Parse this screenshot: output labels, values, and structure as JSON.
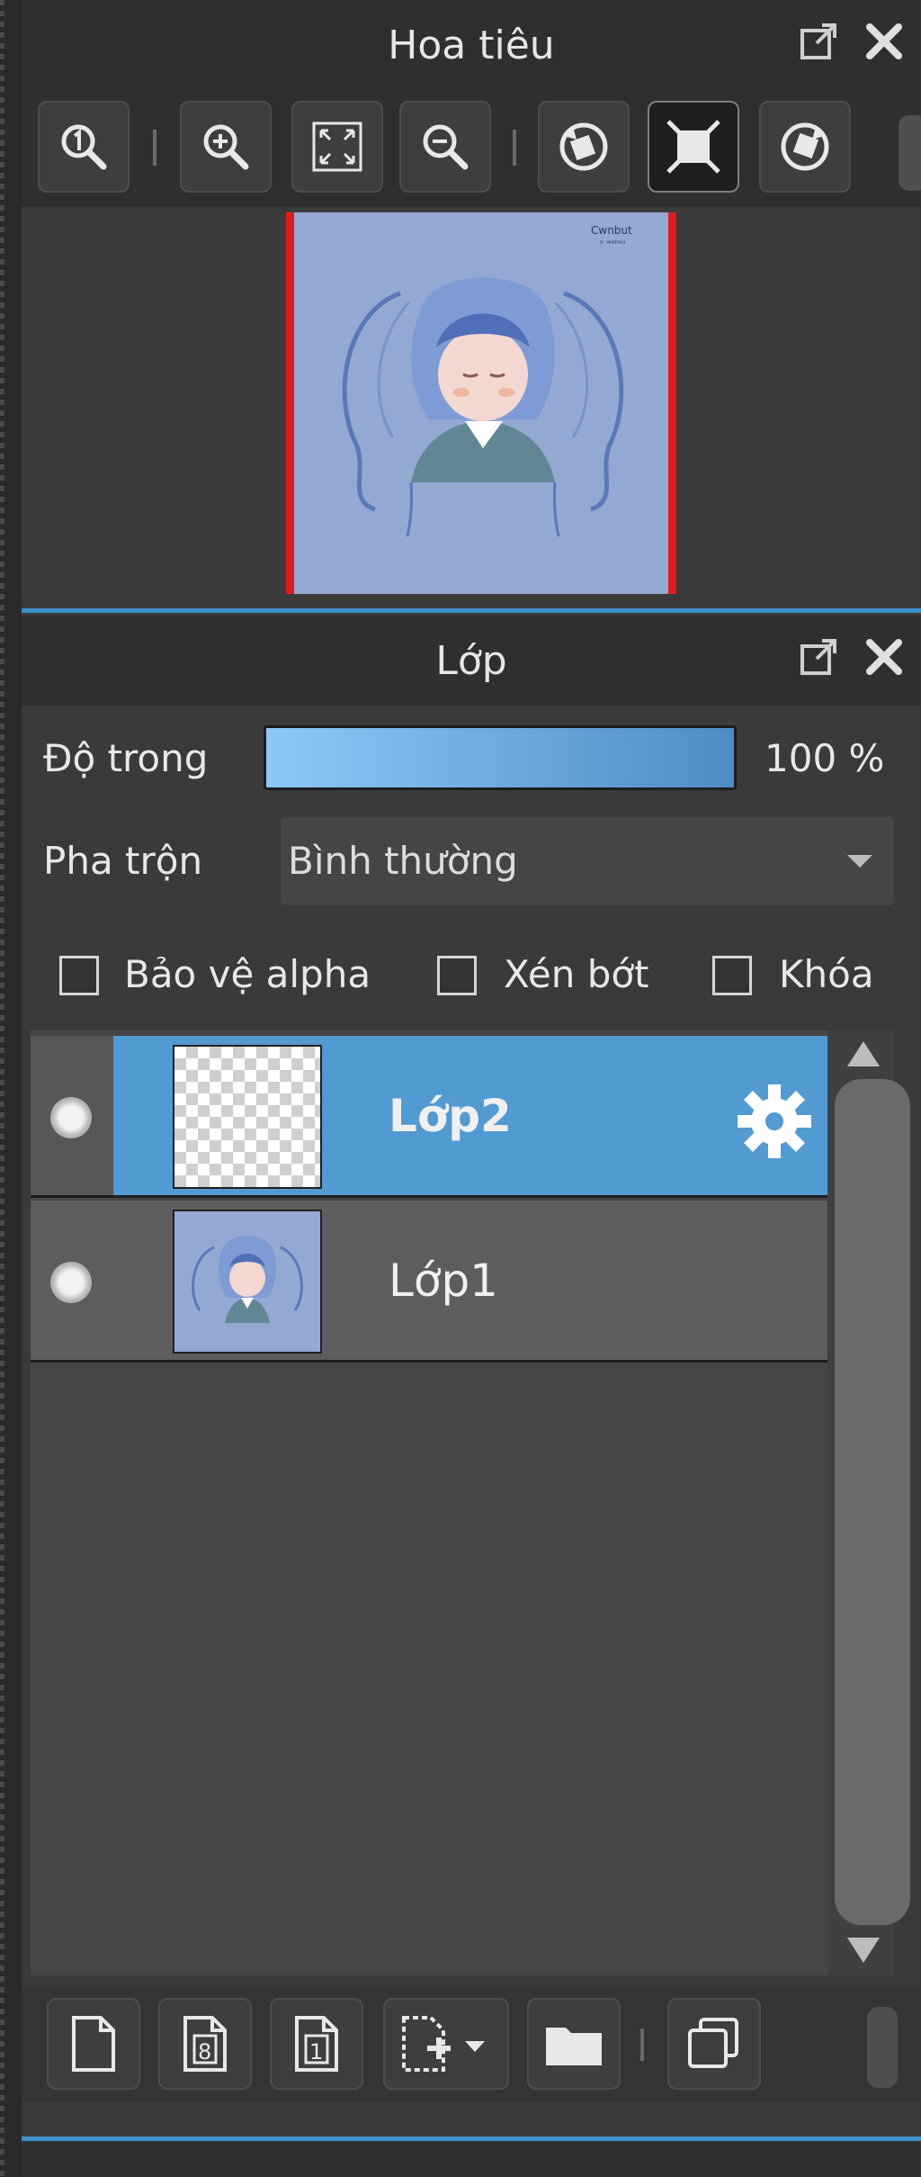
{
  "navigator": {
    "title": "Hoa tiêu",
    "tools": [
      "zoom-actual-icon",
      "zoom-in-icon",
      "fit-screen-icon",
      "zoom-out-icon",
      "rotate-left-icon",
      "fill-screen-icon",
      "rotate-right-icon"
    ]
  },
  "layers_panel": {
    "title": "Lớp",
    "opacity_label": "Độ trong",
    "opacity_value": "100 %",
    "opacity_fraction": 1.0,
    "blend_label": "Pha trộn",
    "blend_value": "Bình thường",
    "checkboxes": {
      "alpha": "Bảo vệ alpha",
      "clip": "Xén bớt",
      "lock": "Khóa"
    },
    "layers": [
      {
        "name": "Lớp2",
        "selected": true
      },
      {
        "name": "Lớp1",
        "selected": false
      }
    ]
  },
  "colors": {
    "selection": "#529ad2",
    "accent": "#3e90c8",
    "canvas_bg": "#93a9d2",
    "nav_frame": "#e01b1b"
  }
}
